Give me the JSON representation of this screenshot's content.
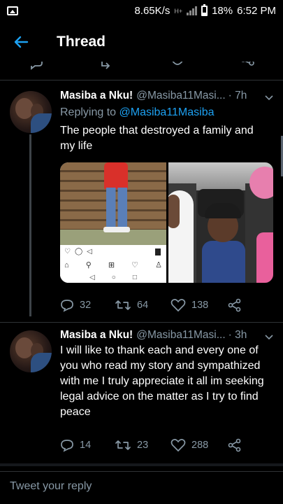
{
  "status_bar": {
    "speed": "8.65K/s",
    "network": "H+",
    "battery": "18%",
    "time": "6:52 PM"
  },
  "header": {
    "title": "Thread"
  },
  "tweets": [
    {
      "name": "Masiba a Nku!",
      "handle": "@Masiba11Masi...",
      "time": "· 7h",
      "reply_prefix": "Replying to ",
      "reply_mention": "@Masiba11Masiba",
      "text": "The people that destroyed a family and my life",
      "replies": "32",
      "retweets": "64",
      "likes": "138"
    },
    {
      "name": "Masiba a Nku!",
      "handle": "@Masiba11Masi...",
      "time": "· 3h",
      "text": "I will like to thank each and every one of you who read my story and sympathized with me I truly appreciate it all im seeking legal advice on the matter as I try to find peace",
      "replies": "14",
      "retweets": "23",
      "likes": "288"
    }
  ],
  "reply_bar": {
    "placeholder": "Tweet your reply"
  },
  "icons": {
    "accent": "#1da1f2",
    "muted": "#8899a6"
  }
}
